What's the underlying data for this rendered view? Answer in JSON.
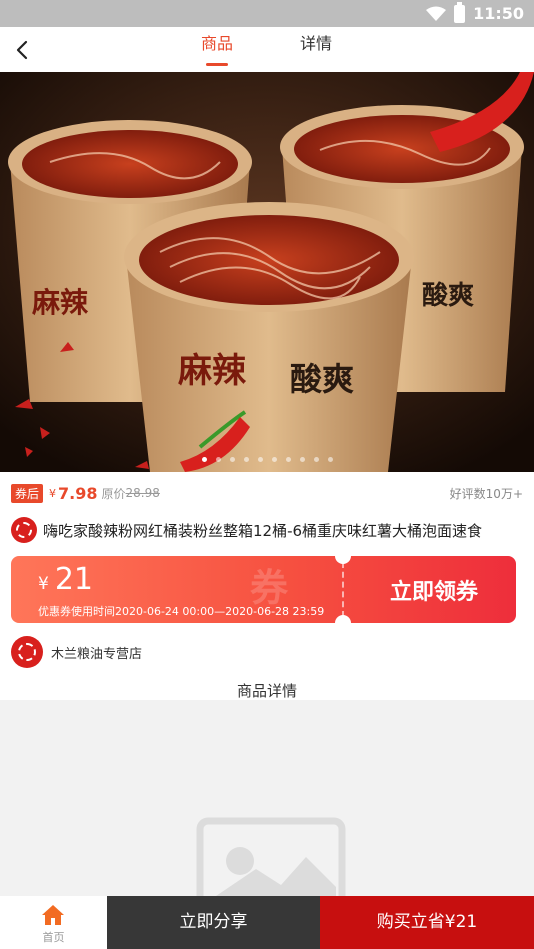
{
  "status_bar": {
    "time": "11:50",
    "icons": [
      "wifi-icon",
      "battery-icon"
    ]
  },
  "header": {
    "back_icon": "back-arrow-icon",
    "tabs": [
      {
        "label": "商品",
        "active": true
      },
      {
        "label": "详情",
        "active": false
      }
    ]
  },
  "hero": {
    "image_icon": "product-photo",
    "slide_count": 10,
    "active_slide": 1
  },
  "price": {
    "coupon_tag": "券后",
    "symbol": "¥",
    "value": "7.98",
    "original_label": "原价",
    "original_price": "28.98",
    "praise": "好评数10万+"
  },
  "product": {
    "title": "嗨吃家酸辣粉网红桶装粉丝整箱12桶-6桶重庆味红薯大桶泡面速食"
  },
  "coupon": {
    "symbol": "¥",
    "amount": "21",
    "watermark": "券",
    "period": "优惠券使用时间2020-06-24 00:00—2020-06-28 23:59",
    "action": "立即领券"
  },
  "shop": {
    "name": "木兰粮油专营店"
  },
  "detail": {
    "heading": "商品详情",
    "placeholder_icon": "image-placeholder-icon"
  },
  "bottom_bar": {
    "home_label": "首页",
    "share_label": "立即分享",
    "buy_label": "购买立省¥21"
  },
  "colors": {
    "accent": "#e8492b",
    "buy": "#c70f0f",
    "share": "#373737"
  }
}
